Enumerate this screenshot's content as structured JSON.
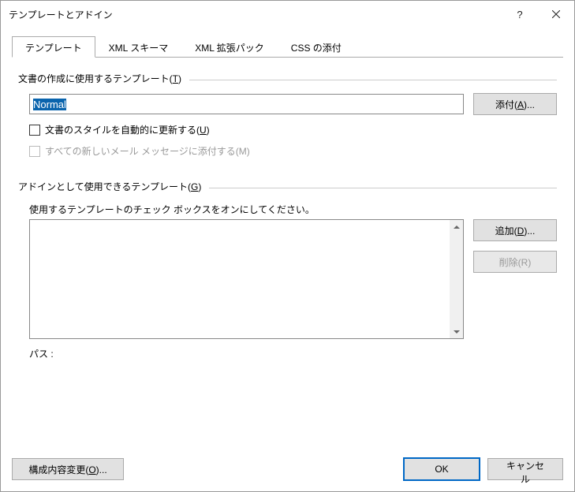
{
  "dialog": {
    "title": "テンプレートとアドイン"
  },
  "tabs": {
    "templates": "テンプレート",
    "xml_schema": "XML スキーマ",
    "xml_expansion": "XML 拡張パック",
    "css_attach": "CSS の添付"
  },
  "section1": {
    "label_prefix": "文書の作成に使用するテンプレート(",
    "label_key": "T",
    "label_suffix": ")",
    "input_value": "Normal",
    "attach_btn_prefix": "添付(",
    "attach_btn_key": "A",
    "attach_btn_suffix": ")...",
    "auto_update_prefix": "文書のスタイルを自動的に更新する(",
    "auto_update_key": "U",
    "auto_update_suffix": ")",
    "attach_all_mail": "すべての新しいメール メッセージに添付する(M)"
  },
  "section2": {
    "label_prefix": "アドインとして使用できるテンプレート(",
    "label_key": "G",
    "label_suffix": ")",
    "instruction": "使用するテンプレートのチェック ボックスをオンにしてください。",
    "add_btn_prefix": "追加(",
    "add_btn_key": "D",
    "add_btn_suffix": ")...",
    "remove_btn": "削除(R)",
    "path_label": "パス :"
  },
  "footer": {
    "organizer_prefix": "構成内容変更(",
    "organizer_key": "O",
    "organizer_suffix": ")...",
    "ok": "OK",
    "cancel": "キャンセル"
  }
}
